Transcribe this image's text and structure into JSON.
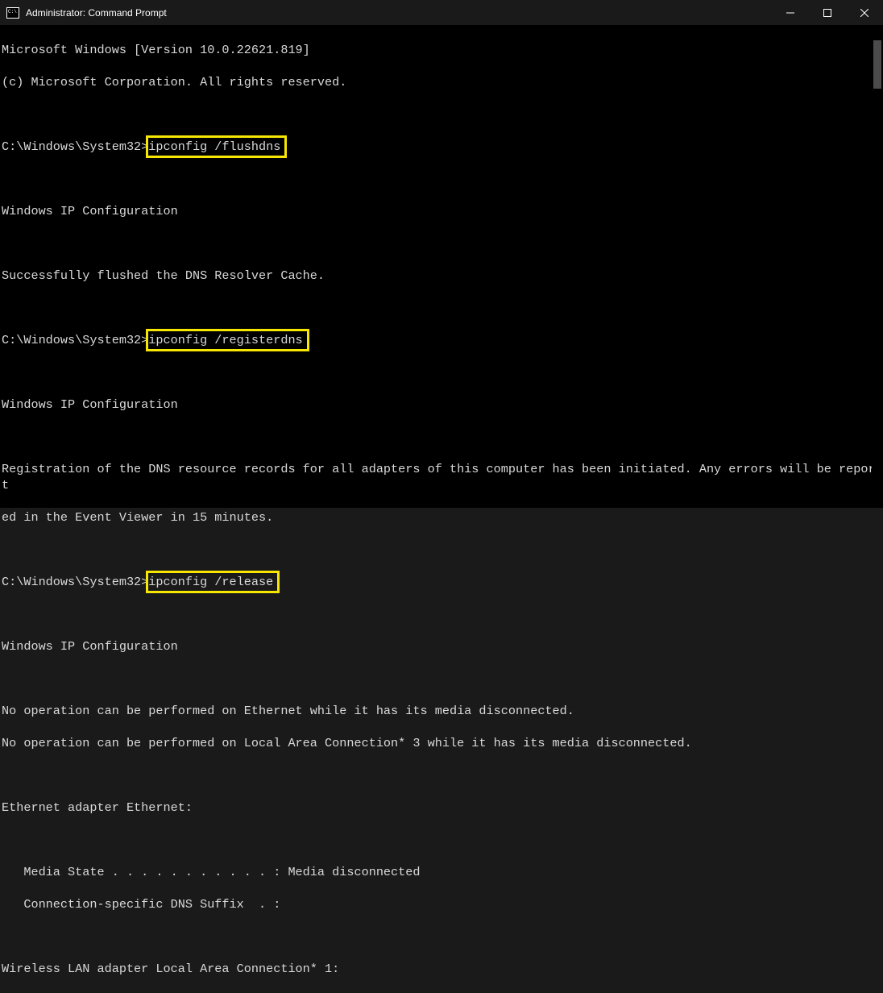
{
  "titlebar": {
    "title": "Administrator: Command Prompt"
  },
  "terminal": {
    "header1": "Microsoft Windows [Version 10.0.22621.819]",
    "header2": "(c) Microsoft Corporation. All rights reserved.",
    "prompt": "C:\\Windows\\System32>",
    "cmd1": "ipconfig /flushdns",
    "ipconf_header": "Windows IP Configuration",
    "flush_msg": "Successfully flushed the DNS Resolver Cache.",
    "cmd2": "ipconfig /registerdns",
    "reg_msg1": "Registration of the DNS resource records for all adapters of this computer has been initiated. Any errors will be report",
    "reg_msg2": "ed in the Event Viewer in 15 minutes.",
    "cmd3": "ipconfig /release",
    "noop1": "No operation can be performed on Ethernet while it has its media disconnected.",
    "noop2": "No operation can be performed on Local Area Connection* 3 while it has its media disconnected.",
    "eth_header": "Ethernet adapter Ethernet:",
    "media_state": "   Media State . . . . . . . . . . . : Media disconnected",
    "dns_suffix": "   Connection-specific DNS Suffix  . :",
    "wlan_header": "Wireless LAN adapter Local Area Connection* 1:"
  }
}
